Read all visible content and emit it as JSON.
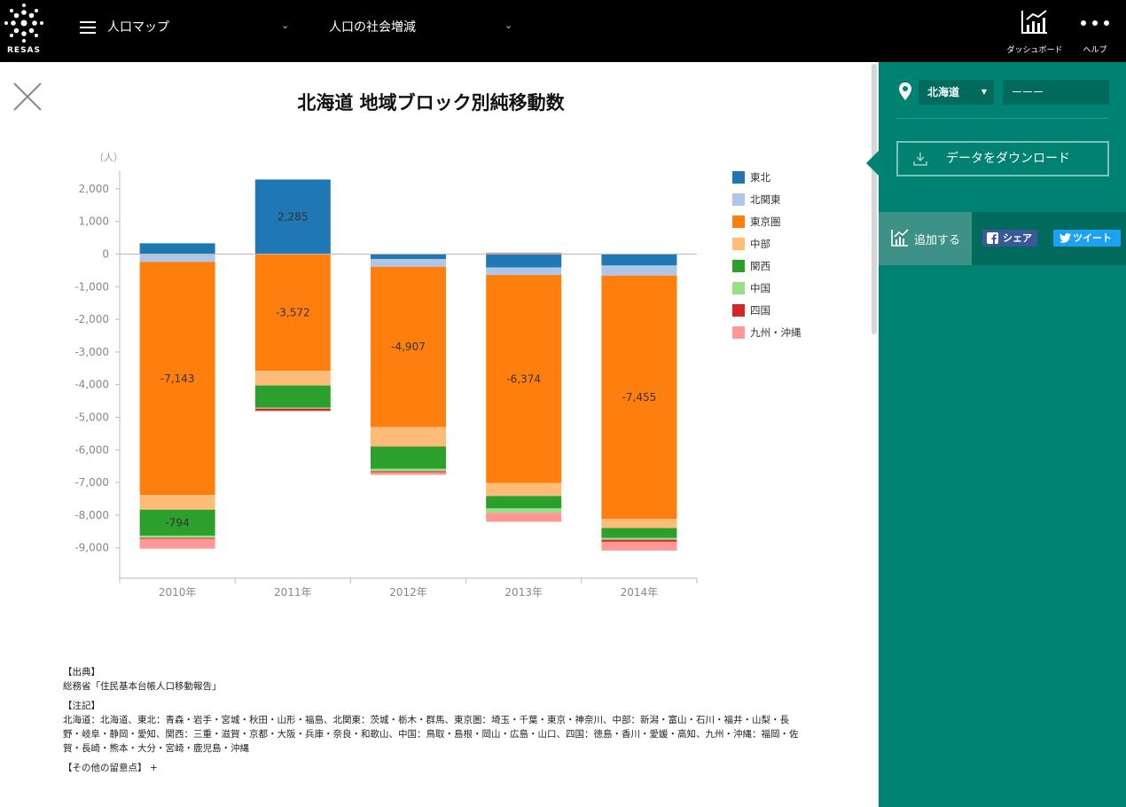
{
  "header": {
    "logo_text": "RESAS",
    "map_select": "人口マップ",
    "sub_select": "人口の社会増減",
    "dashboard_label": "ダッシュボード",
    "help_label": "ヘルプ"
  },
  "sidebar": {
    "prefecture": "北海道",
    "city": "ーーー",
    "download_label": "データをダウンロード",
    "add_label": "追加する",
    "share_label": "シェア",
    "tweet_label": "ツイート"
  },
  "notes": {
    "source_heading": "【出典】",
    "source_text": "総務省「住民基本台帳人口移動報告」",
    "note_heading": "【注記】",
    "note_text": "北海道：北海道、東北：青森・岩手・宮城・秋田・山形・福島、北関東：茨城・栃木・群馬、東京圏：埼玉・千葉・東京・神奈川、中部：新潟・富山・石川・福井・山梨・長野・岐阜・静岡・愛知、関西：三重・滋賀・京都・大阪・兵庫・奈良・和歌山、中国：鳥取・島根・岡山・広島・山口、四国：徳島・香川・愛媛・高知、九州・沖縄：福岡・佐賀・長崎・熊本・大分・宮崎・鹿児島・沖縄",
    "other_label": "【その他の留意点】 +"
  },
  "chart_data": {
    "type": "bar",
    "stacked": true,
    "title": "北海道 地域ブロック別純移動数",
    "ylabel": "（人）",
    "xlabel": "",
    "ylim": [
      -9600,
      2600
    ],
    "yticks": [
      2000,
      1000,
      0,
      -1000,
      -2000,
      -3000,
      -4000,
      -5000,
      -6000,
      -7000,
      -8000,
      -9000
    ],
    "ytick_labels": [
      "2,000",
      "1,000",
      "0",
      "-1,000",
      "-2,000",
      "-3,000",
      "-4,000",
      "-5,000",
      "-6,000",
      "-7,000",
      "-8,000",
      "-9,000"
    ],
    "categories": [
      "2010年",
      "2011年",
      "2012年",
      "2013年",
      "2014年"
    ],
    "legend_position": "right",
    "grid": false,
    "series": [
      {
        "name": "東北",
        "color": "#1f77b4",
        "values": [
          330,
          2285,
          -150,
          -410,
          -350
        ]
      },
      {
        "name": "北関東",
        "color": "#aec7e8",
        "values": [
          -240,
          -5,
          -240,
          -230,
          -310
        ]
      },
      {
        "name": "東京圏",
        "color": "#ff7f0e",
        "values": [
          -7143,
          -3572,
          -4907,
          -6374,
          -7455
        ]
      },
      {
        "name": "中部",
        "color": "#ffbb78",
        "values": [
          -450,
          -450,
          -600,
          -400,
          -280
        ]
      },
      {
        "name": "関西",
        "color": "#2ca02c",
        "values": [
          -794,
          -680,
          -680,
          -380,
          -300
        ]
      },
      {
        "name": "中国",
        "color": "#98df8a",
        "values": [
          -70,
          -30,
          -80,
          -130,
          -60
        ]
      },
      {
        "name": "四国",
        "color": "#d62728",
        "values": [
          -30,
          -60,
          -30,
          30,
          -60
        ]
      },
      {
        "name": "九州・沖縄",
        "color": "#ff9896",
        "values": [
          -300,
          -20,
          -80,
          -280,
          -270
        ]
      }
    ],
    "data_labels": [
      {
        "series": "東北",
        "category": "2011年",
        "text": "2,285"
      },
      {
        "series": "東京圏",
        "category": "2010年",
        "text": "-7,143"
      },
      {
        "series": "東京圏",
        "category": "2011年",
        "text": "-3,572"
      },
      {
        "series": "東京圏",
        "category": "2012年",
        "text": "-4,907"
      },
      {
        "series": "東京圏",
        "category": "2013年",
        "text": "-6,374"
      },
      {
        "series": "東京圏",
        "category": "2014年",
        "text": "-7,455"
      },
      {
        "series": "関西",
        "category": "2010年",
        "text": "-794"
      }
    ]
  }
}
